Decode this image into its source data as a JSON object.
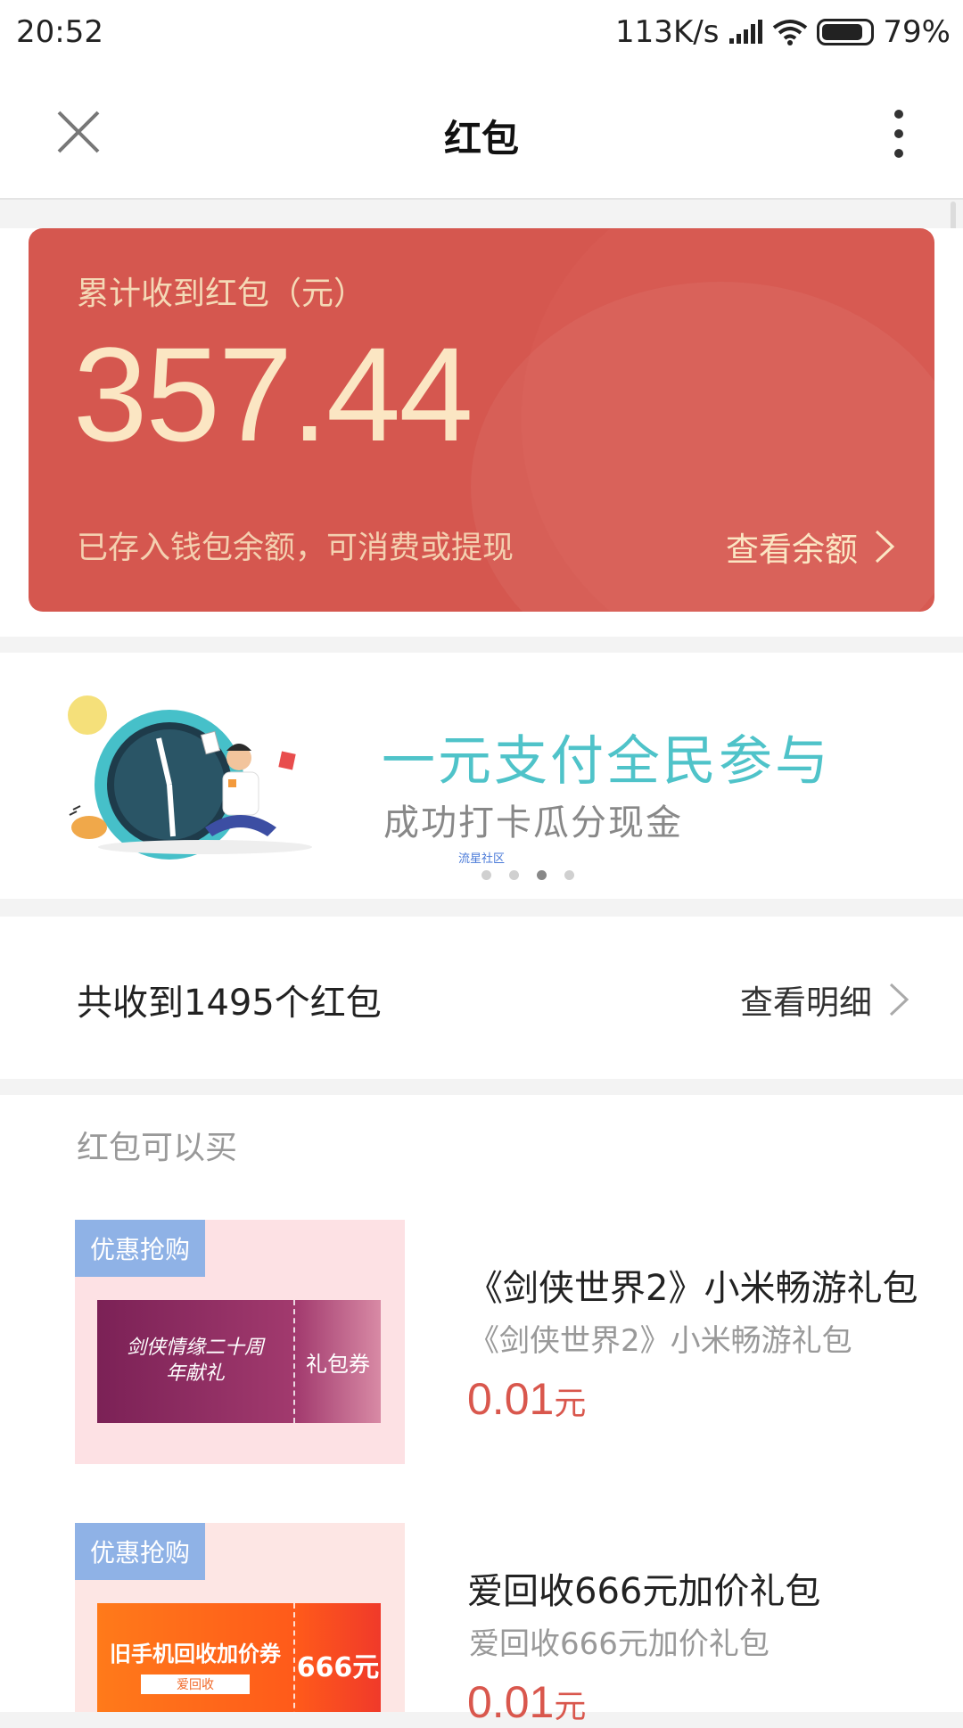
{
  "status": {
    "time": "20:52",
    "speed": "113K/s",
    "battery": "79%"
  },
  "header": {
    "title": "红包"
  },
  "summary": {
    "label": "累计收到红包（元）",
    "amount": "357.44",
    "note": "已存入钱包余额，可消费或提现",
    "view_label": "查看余额"
  },
  "banner": {
    "headline": "一元支付全民参与",
    "subline": "成功打卡瓜分现金",
    "tag": "流星社区",
    "dots": 4,
    "active_dot": 3
  },
  "count": {
    "text": "共收到1495个红包",
    "link": "查看明细"
  },
  "buy": {
    "title": "红包可以买",
    "items": [
      {
        "badge": "优惠抢购",
        "coupon_art": "剑侠情缘二十周年献礼",
        "coupon_tag": "礼包券",
        "name": "《剑侠世界2》小米畅游礼包",
        "sub": "《剑侠世界2》小米畅游礼包",
        "price": "0.01",
        "unit": "元"
      },
      {
        "badge": "优惠抢购",
        "coupon_art": "旧手机回收加价券",
        "coupon_brand": "爱回收",
        "coupon_tag": "666元",
        "name": "爱回收666元加价礼包",
        "sub": "爱回收666元加价礼包",
        "price": "0.01",
        "unit": "元"
      }
    ]
  },
  "colors": {
    "accent": "#d75a52",
    "gold": "#fbe6c3",
    "teal": "#4fc3c9",
    "price": "#d9574d",
    "badge": "#8fb2e6"
  }
}
